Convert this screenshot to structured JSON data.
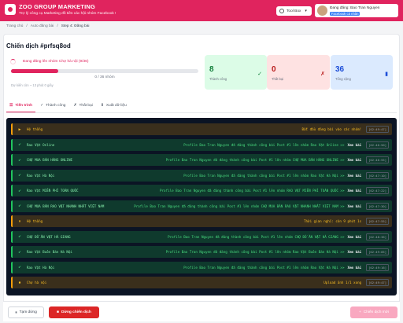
{
  "colors": {
    "brand": "#e0245e",
    "success": "#15803d",
    "fail": "#b91c1c",
    "total": "#1d4ed8",
    "console_bg": "#0b1424"
  },
  "header": {
    "title": "ZOO GROUP MARKETING",
    "subtitle": "Trợ lý công cụ Marketing đồ tiên các hội nhóm Facebook !",
    "toolbox_label": "Tool Box",
    "user_name": "Đang đăng: Bao Tran Nguyen",
    "user_badge": "Facebook cá nhân"
  },
  "breadcrumb": [
    "Trang chủ",
    "/",
    "Auto đăng bài",
    "/",
    "Step 4: Đăng bài"
  ],
  "page_title": "Chiến dịch #prfsq8od",
  "progress": {
    "label": "Đang đăng lên nhóm Chợ hà nội (9/36)",
    "count": "0 / 36 nhóm",
    "fraction": 0.25,
    "eta": "Dự kiến còn ~ 13 phút 0 giây"
  },
  "stats": [
    {
      "value": "8",
      "label": "Thành công",
      "icon": "check-icon",
      "glyph": "✓"
    },
    {
      "value": "0",
      "label": "Thất bại",
      "icon": "x-icon",
      "glyph": "✗"
    },
    {
      "value": "36",
      "label": "Tổng cộng",
      "icon": "chart-icon",
      "glyph": "▮"
    }
  ],
  "tabs": [
    {
      "label": "Tiến trình",
      "glyph": "☰"
    },
    {
      "label": "Thành công",
      "glyph": "✓"
    },
    {
      "label": "Thất bại",
      "glyph": "✗"
    },
    {
      "label": "Xuất dữ liệu",
      "glyph": "⬇"
    }
  ],
  "log": [
    {
      "kind": "system",
      "glyph": "▶",
      "group": "Hệ thống",
      "message": "Bắt đầu đăng bài vào các nhóm!",
      "link": "",
      "time": "[02:49:47]"
    },
    {
      "kind": "success",
      "glyph": "✔",
      "group": "Rao Vặt Online",
      "message": "Profile Bao Tran Nguyen đã đăng thành công bài Post #1 lên nhóm Rao Vặt Online >>",
      "link": "Xem bài",
      "time": "[02:46:50]"
    },
    {
      "kind": "success",
      "glyph": "✔",
      "group": "CHỢ MUA BÁN HÀNG ONLINE",
      "message": "Profile Bao Tran Nguyen đã đăng thành công bài Post #1 lên nhóm CHỢ MUA BÁN HÀNG ONLINE >>",
      "link": "Xem bài",
      "time": "[02:46:55]"
    },
    {
      "kind": "success",
      "glyph": "✔",
      "group": "Rao Vặt Hà Nội",
      "message": "Profile Bao Tran Nguyen đã đăng thành công bài Post #1 lên nhóm Rao Vặt Hà Nội >>",
      "link": "Xem bài",
      "time": "[02:47:10]"
    },
    {
      "kind": "success",
      "glyph": "✔",
      "group": "Rao Vặt MIỀN PHÍ TOÀN QUỐC",
      "message": "Profile Bao Tran Nguyen đã đăng thành công bài Post #1 lên nhóm RAO VẶT MIỀN PHÍ TOÀN QUỐC >>",
      "link": "Xem bài",
      "time": "[02:47:22]"
    },
    {
      "kind": "success",
      "glyph": "✔",
      "group": "CHỢ MUA BÁN RAO VẶT NHANH NHẤT VIỆT NAM",
      "message": "Profile Bao Tran Nguyen đã đăng thành công bài Post #1 lên nhóm CHỢ MUA BÁN RAO VẶT NHANH NHẤT VIỆT NAM >>",
      "link": "Xem bài",
      "time": "[02:47:30]"
    },
    {
      "kind": "system",
      "glyph": "⏸",
      "group": "Hệ thống",
      "message": "Thời gian nghỉ: còn 9 phút 1s",
      "link": "",
      "time": "[02:47:55]"
    },
    {
      "kind": "success",
      "glyph": "✔",
      "group": "CHỢ ĐỒ ĂN VẶT HÀ GIANG",
      "message": "Profile Bao Tran Nguyen đã đăng thành công bài Post #1 lên nhóm CHỢ ĐỒ ĂN VẶT HÀ GIANG >>",
      "link": "Xem bài",
      "time": "[02:48:36]"
    },
    {
      "kind": "success",
      "glyph": "✔",
      "group": "Rao Vặt Buôn Bán Hà Nội",
      "message": "Profile Bao Tran Nguyen đã đăng thành công bài Post #1 lên nhóm Rao Vặt Buôn Bán Hà Nội >>",
      "link": "Xem bài",
      "time": "[02:49:05]"
    },
    {
      "kind": "success",
      "glyph": "✔",
      "group": "Rao Vặt Hà Nội",
      "message": "Profile Bao Tran Nguyen đã đăng thành công bài Post #1 lên nhóm Rao Vặt Hà Nội >>",
      "link": "Xem bài",
      "time": "[02:49:16]"
    },
    {
      "kind": "system",
      "glyph": "⏹",
      "group": "Chợ hà nội",
      "message": "Upload ảnh 1/1 xong",
      "link": "",
      "time": "[02:49:47]"
    }
  ],
  "footer": {
    "pause_label": "Tạm dừng",
    "stop_label": "Dừng chiến dịch",
    "new_label": "Chiến dịch mới"
  }
}
